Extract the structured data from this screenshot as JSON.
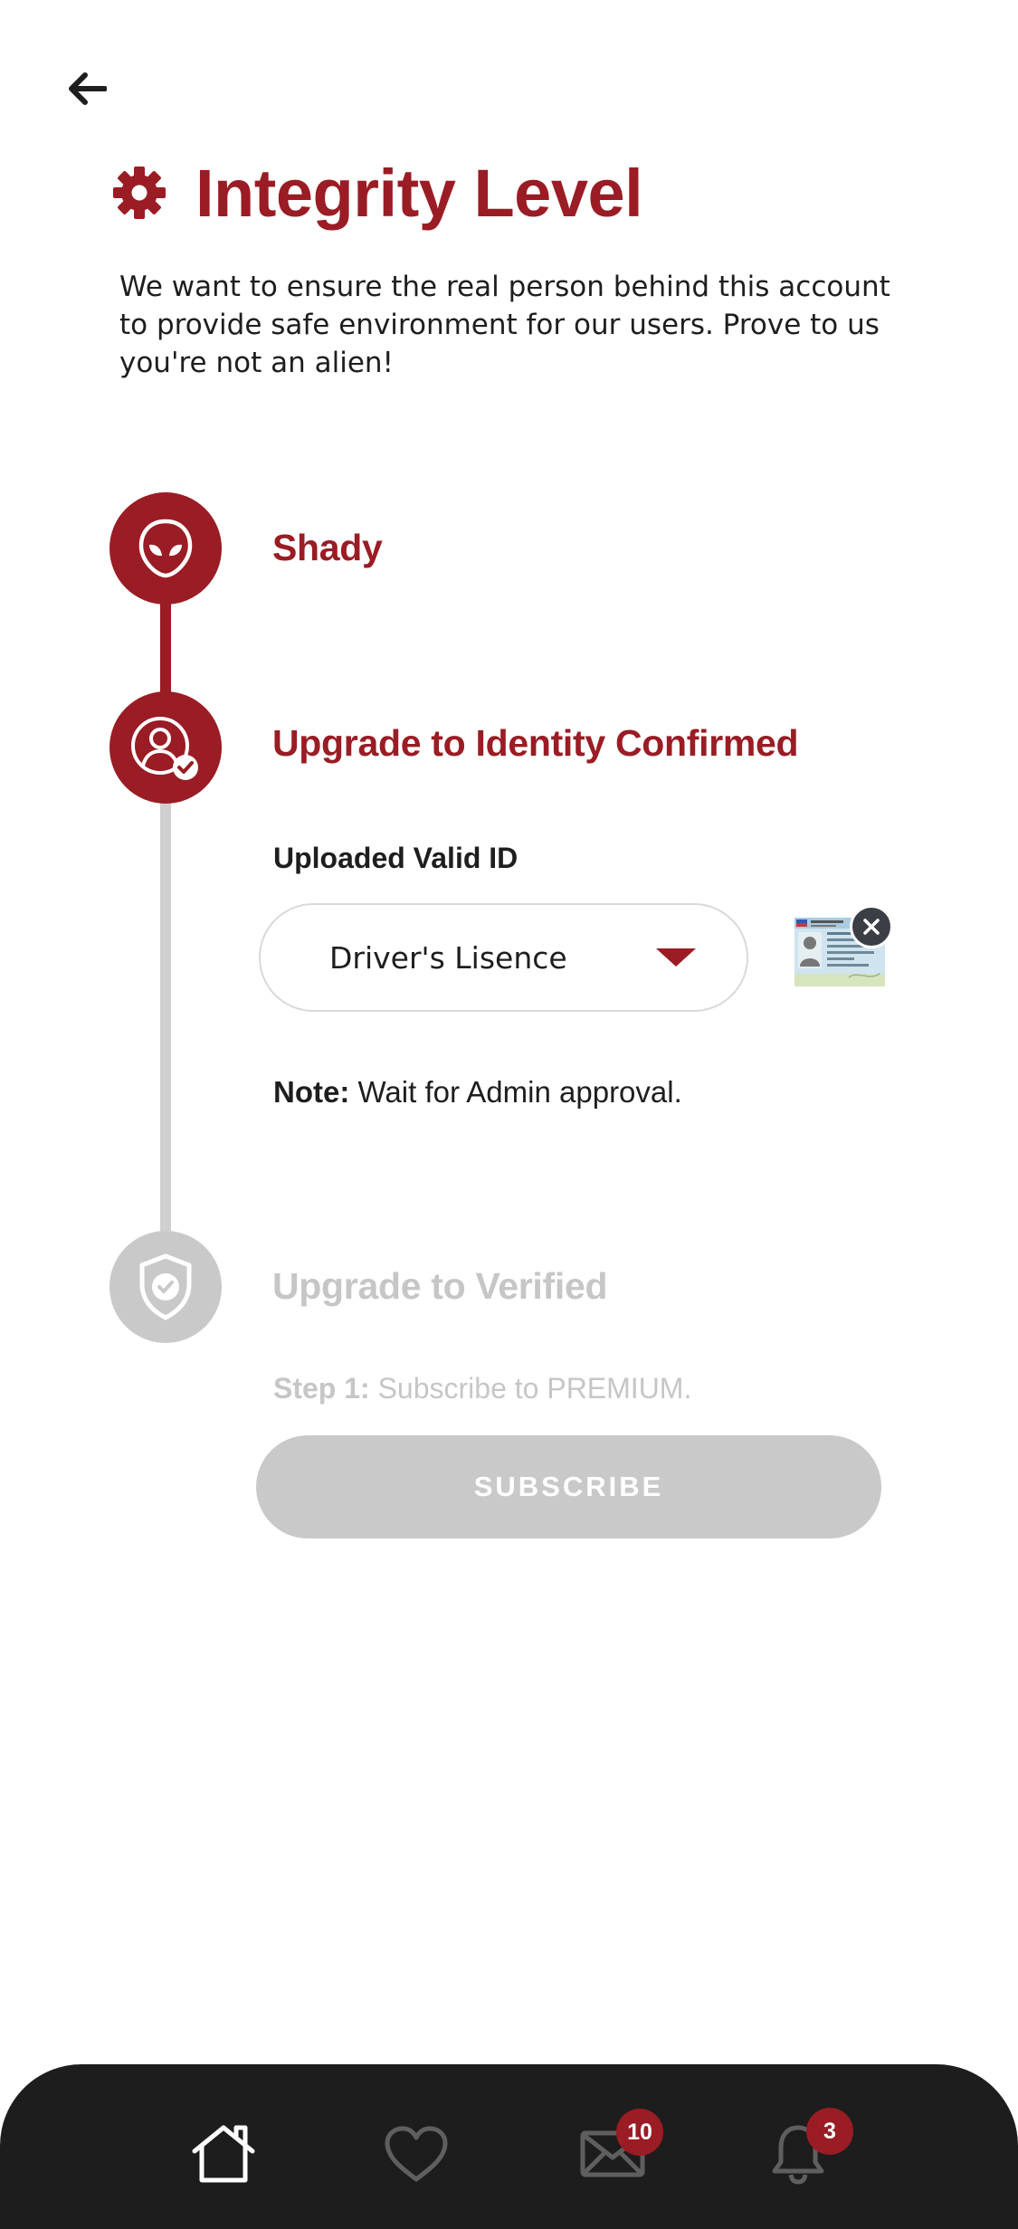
{
  "header": {
    "title": "Integrity Level",
    "intro": "We want to ensure the real person behind this account to provide safe environment for our users. Prove to us you're not an alien!"
  },
  "steps": [
    {
      "label": "Shady",
      "state": "complete",
      "icon": "alien-icon"
    },
    {
      "label": "Upgrade to Identity Confirmed",
      "state": "active",
      "icon": "user-check-icon"
    },
    {
      "label": "Upgrade to Verified",
      "state": "locked",
      "icon": "shield-check-icon"
    }
  ],
  "identity": {
    "uploaded_label": "Uploaded Valid ID",
    "id_type": "Driver's Lisence",
    "note_label": "Note:",
    "note_text": " Wait for Admin approval."
  },
  "verified": {
    "step_label": "Step 1:",
    "step_text": " Subscribe to PREMIUM.",
    "subscribe_label": "SUBSCRIBE"
  },
  "nav": {
    "items": [
      {
        "name": "home",
        "icon": "home-icon",
        "active": true
      },
      {
        "name": "likes",
        "icon": "heart-icon"
      },
      {
        "name": "messages",
        "icon": "mail-icon",
        "badge": "10"
      },
      {
        "name": "notifications",
        "icon": "bell-icon",
        "badge": "3"
      }
    ]
  },
  "colors": {
    "accent": "#9a1c24",
    "inactive": "#c9c9c9",
    "nav_bg": "#1d1d1d"
  }
}
